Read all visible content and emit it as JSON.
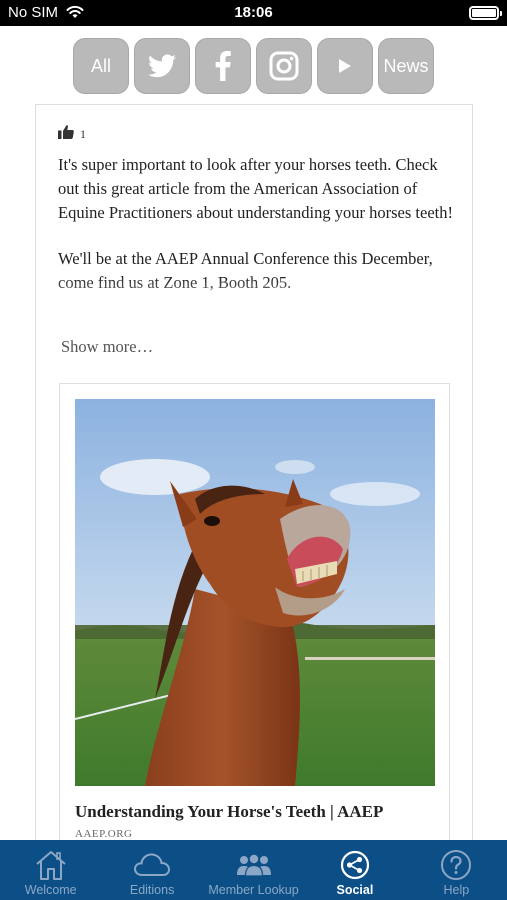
{
  "status_bar": {
    "carrier": "No SIM",
    "time": "18:06"
  },
  "filters": [
    {
      "label": "All",
      "icon": "all"
    },
    {
      "label": "",
      "icon": "twitter-icon"
    },
    {
      "label": "",
      "icon": "facebook-icon"
    },
    {
      "label": "",
      "icon": "instagram-icon"
    },
    {
      "label": "",
      "icon": "youtube-icon"
    },
    {
      "label": "News",
      "icon": "news"
    }
  ],
  "post": {
    "likes": "1",
    "paragraph_1": "It's super important to look after your horses teeth. Check out this great article from the American Association of Equine Practitioners about understanding your horses teeth!",
    "paragraph_2": "We'll be at the AAEP Annual Conference this December, come find us at Zone 1, Booth 205.",
    "show_more": "Show more…",
    "link": {
      "title": "Understanding Your Horse's Teeth | AAEP",
      "domain": "AAEP.ORG"
    }
  },
  "tabs": [
    {
      "label": "Welcome",
      "icon": "house-icon",
      "active": false
    },
    {
      "label": "Editions",
      "icon": "cloud-icon",
      "active": false
    },
    {
      "label": "Member Lookup",
      "icon": "people-icon",
      "active": false
    },
    {
      "label": "Social",
      "icon": "share-icon",
      "active": true
    },
    {
      "label": "Help",
      "icon": "question-icon",
      "active": false
    }
  ],
  "colors": {
    "tab_bar": "#0c4f87",
    "filter_button": "#b9b9b9",
    "tab_label_inactive": "#8ba7c5",
    "tab_label_active": "#ffffff"
  }
}
